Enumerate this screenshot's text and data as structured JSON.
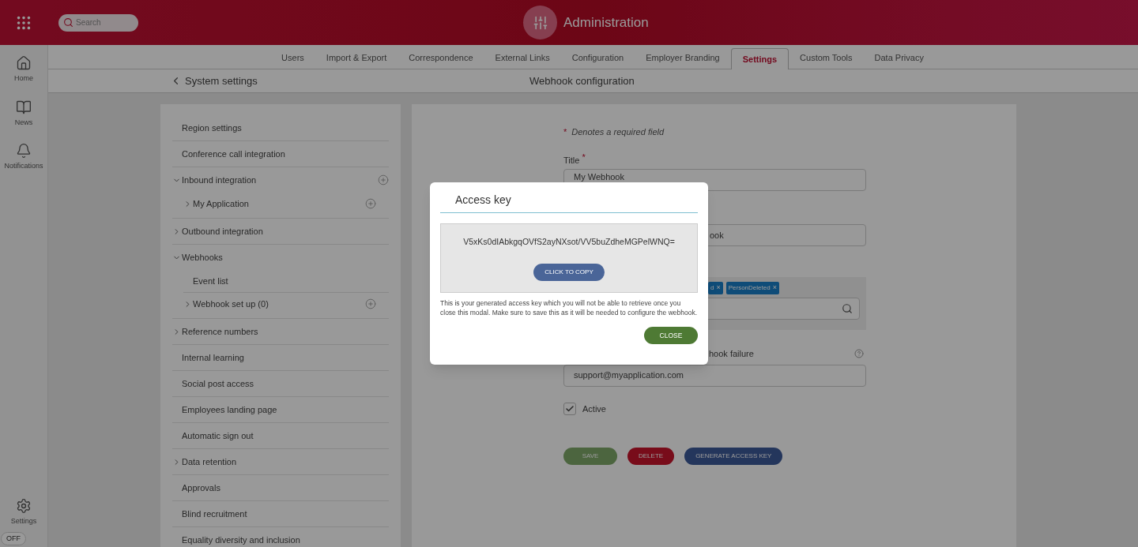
{
  "header": {
    "title": "Administration",
    "search": {
      "placeholder": "Search"
    }
  },
  "rail": {
    "items": [
      {
        "kind": "home",
        "label": "Home"
      },
      {
        "kind": "news",
        "label": "News"
      },
      {
        "kind": "bell",
        "label": "Notifications"
      }
    ],
    "footer": {
      "kind": "settings",
      "label": "Settings"
    },
    "toggle": {
      "label": "OFF",
      "on": false
    }
  },
  "tabs": [
    {
      "label": "Users",
      "selected": false
    },
    {
      "label": "Import & Export",
      "selected": false
    },
    {
      "label": "Correspondence",
      "selected": false
    },
    {
      "label": "External Links",
      "selected": false
    },
    {
      "label": "Configuration",
      "selected": false
    },
    {
      "label": "Employer Branding",
      "selected": false
    },
    {
      "label": "Settings",
      "selected": true
    },
    {
      "label": "Custom Tools",
      "selected": false
    },
    {
      "label": "Data Privacy",
      "selected": false
    }
  ],
  "breadcrumb": {
    "back": "System settings",
    "title": "Webhook configuration"
  },
  "settings_menu": [
    {
      "label": "Region settings",
      "kind": "leaf"
    },
    {
      "label": "Conference call integration",
      "kind": "leaf"
    },
    {
      "label": "Inbound integration",
      "kind": "group",
      "expanded": true,
      "addable": true,
      "children": [
        {
          "label": "My Application",
          "kind": "group",
          "expanded": false,
          "addable": true
        }
      ]
    },
    {
      "label": "Outbound integration",
      "kind": "group",
      "expanded": false,
      "addable": false
    },
    {
      "label": "Webhooks",
      "kind": "group",
      "expanded": true,
      "addable": false,
      "children": [
        {
          "label": "Event list",
          "kind": "leaf"
        },
        {
          "label": "Webhook set up (0)",
          "kind": "group",
          "expanded": false,
          "addable": true
        }
      ]
    },
    {
      "label": "Reference numbers",
      "kind": "group",
      "expanded": false,
      "addable": false
    },
    {
      "label": "Internal learning",
      "kind": "leaf"
    },
    {
      "label": "Social post access",
      "kind": "leaf"
    },
    {
      "label": "Employees landing page",
      "kind": "leaf"
    },
    {
      "label": "Automatic sign out",
      "kind": "leaf"
    },
    {
      "label": "Data retention",
      "kind": "group",
      "expanded": false,
      "addable": false
    },
    {
      "label": "Approvals",
      "kind": "leaf"
    },
    {
      "label": "Blind recruitment",
      "kind": "leaf"
    },
    {
      "label": "Equality diversity and inclusion",
      "kind": "leaf"
    }
  ],
  "form": {
    "required_mark": "*",
    "required_note": "Denotes a required field",
    "title_field": {
      "label": "Title",
      "required": true,
      "required_mark": "*",
      "value": "My Webhook"
    },
    "field_2": {
      "value": "ook"
    },
    "events": {
      "tags": [
        {
          "label": "d",
          "remove": "×"
        },
        {
          "label": "PersonDeleted",
          "remove": "×"
        }
      ]
    },
    "failure_email": {
      "label": "hook failure",
      "value": "support@myapplication.com"
    },
    "active": {
      "label": "Active",
      "checked": true
    },
    "buttons": [
      {
        "label": "SAVE",
        "kind": "save",
        "disabled": true
      },
      {
        "label": "DELETE",
        "kind": "delete",
        "disabled": false
      },
      {
        "label": "GENERATE ACCESS KEY",
        "kind": "generate",
        "disabled": false
      }
    ]
  },
  "modal": {
    "title": "Access key",
    "key": "V5xKs0dIAbkgqOVfS2ayNXsot/VV5buZdheMGPelWNQ=",
    "copy_button": "CLICK TO COPY",
    "message": "This is your generated access key which you will not be able to retrieve once you close this modal. Make sure to save this as it will be needed to configure the webhook.",
    "close_button": "CLOSE"
  }
}
